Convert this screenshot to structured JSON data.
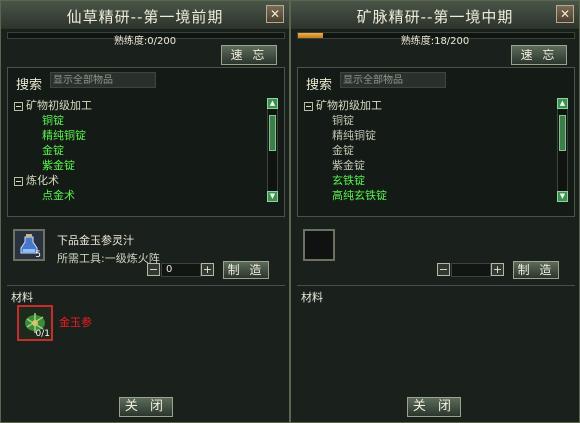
{
  "left": {
    "title": "仙草精研--第一境前期",
    "proficiency": "熟练度:0/200",
    "progress": 0,
    "memo_label": "速 忘",
    "search_label": "搜索",
    "search_placeholder": "显示全部物品",
    "tree": [
      {
        "kind": "cat",
        "label": "矿物初级加工"
      },
      {
        "kind": "item",
        "label": "铜锭",
        "color": "green"
      },
      {
        "kind": "item",
        "label": "精纯铜锭",
        "color": "green"
      },
      {
        "kind": "item",
        "label": "金锭",
        "color": "green"
      },
      {
        "kind": "item",
        "label": "紫金锭",
        "color": "green"
      },
      {
        "kind": "cat",
        "label": "炼化术"
      },
      {
        "kind": "item",
        "label": "点金术",
        "color": "green"
      }
    ],
    "product": {
      "name": "下品金玉参灵汁",
      "tool": "所需工具:一级炼火阵",
      "count": "5",
      "icon": "potion-icon"
    },
    "quantity": "0",
    "make_label": "制 造",
    "materials_label": "材料",
    "material": {
      "name": "金玉参",
      "count": "0/1",
      "icon": "ginseng-icon"
    },
    "close_label": "关 闭"
  },
  "right": {
    "title": "矿脉精研--第一境中期",
    "proficiency": "熟练度:18/200",
    "progress": 0.09,
    "memo_label": "速 忘",
    "search_label": "搜索",
    "search_placeholder": "显示全部物品",
    "tree": [
      {
        "kind": "cat",
        "label": "矿物初级加工"
      },
      {
        "kind": "item",
        "label": "铜锭",
        "color": "gray"
      },
      {
        "kind": "item",
        "label": "精纯铜锭",
        "color": "gray"
      },
      {
        "kind": "item",
        "label": "金锭",
        "color": "gray"
      },
      {
        "kind": "item",
        "label": "紫金锭",
        "color": "gray"
      },
      {
        "kind": "item",
        "label": "玄铁锭",
        "color": "green"
      },
      {
        "kind": "item",
        "label": "高纯玄铁锭",
        "color": "green"
      }
    ],
    "quantity": "",
    "make_label": "制 造",
    "materials_label": "材料",
    "close_label": "关 闭"
  },
  "close_glyph": "✕"
}
